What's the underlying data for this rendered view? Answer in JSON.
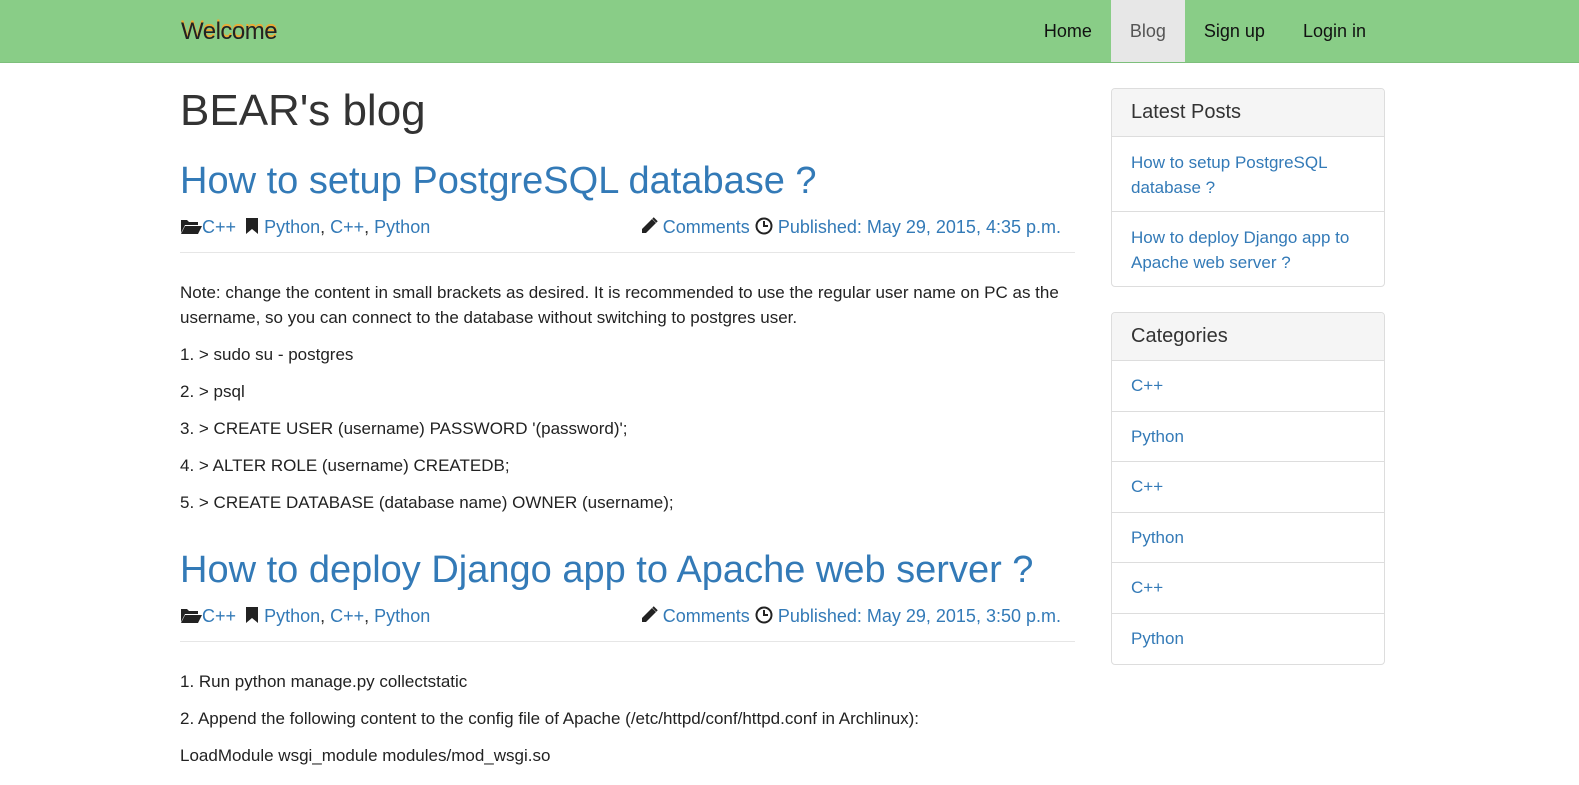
{
  "navbar": {
    "brand": "Welcome",
    "items": [
      {
        "label": "Home"
      },
      {
        "label": "Blog",
        "active": true
      },
      {
        "label": "Sign up"
      },
      {
        "label": "Login in"
      }
    ]
  },
  "blog": {
    "title": "BEAR's blog",
    "posts": [
      {
        "title": "How to setup PostgreSQL database ?",
        "category": "C++",
        "tags": [
          "Python",
          "C++",
          "Python"
        ],
        "comments_label": "Comments",
        "published": "Published: May 29, 2015, 4:35 p.m.",
        "paragraphs": [
          "Note: change the content in small brackets as desired. It is recommended to use the regular user name on PC as the username, so you can connect to the database without switching to postgres user.",
          "1. > sudo su - postgres",
          "2. > psql",
          "3. > CREATE USER (username) PASSWORD '(password)';",
          "4. > ALTER ROLE (username) CREATEDB;",
          "5. > CREATE DATABASE (database name) OWNER (username);"
        ]
      },
      {
        "title": "How to deploy Django app to Apache web server ?",
        "category": "C++",
        "tags": [
          "Python",
          "C++",
          "Python"
        ],
        "comments_label": "Comments",
        "published": "Published: May 29, 2015, 3:50 p.m.",
        "paragraphs": [
          "1. Run python manage.py collectstatic",
          "2. Append the following content to the config file of Apache (/etc/httpd/conf/httpd.conf in Archlinux):",
          "LoadModule wsgi_module modules/mod_wsgi.so"
        ]
      }
    ]
  },
  "sidebar": {
    "latest": {
      "heading": "Latest Posts",
      "items": [
        "How to setup PostgreSQL database ?",
        "How to deploy Django app to Apache web server ?"
      ]
    },
    "categories": {
      "heading": "Categories",
      "items": [
        "C++",
        "Python",
        "C++",
        "Python",
        "C++",
        "Python"
      ]
    }
  },
  "icons": {
    "category": "folder-open-icon",
    "tags": "bookmark-icon",
    "comments": "pencil-icon",
    "published": "clock-icon"
  },
  "colors": {
    "navbar_bg": "#89cd87",
    "link": "#337ab7",
    "active_nav_bg": "#e7e7e7"
  }
}
